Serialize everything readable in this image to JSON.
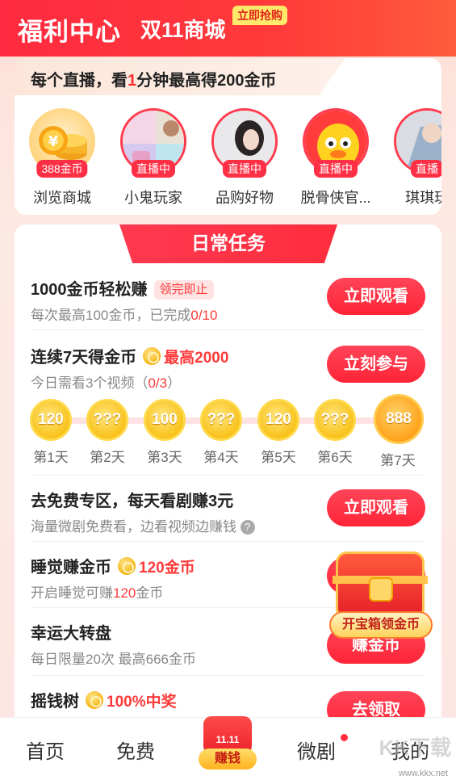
{
  "header": {
    "title": "福利中心",
    "subtitle": "双11商城",
    "badge": "立即抢购"
  },
  "live": {
    "banner_prefix": "每个直播，看",
    "banner_highlight": "1",
    "banner_suffix": "分钟最高得200金币",
    "items": [
      {
        "tag": "388金币",
        "name": "浏览商城"
      },
      {
        "tag": "直播中",
        "name": "小鬼玩家"
      },
      {
        "tag": "直播中",
        "name": "品购好物"
      },
      {
        "tag": "直播中",
        "name": "脱骨侠官..."
      },
      {
        "tag": "直播",
        "name": "琪琪玩"
      }
    ]
  },
  "tasks": {
    "tab_label": "日常任务",
    "task1": {
      "title": "1000金币轻松赚",
      "pill": "领完即止",
      "desc_prefix": "每次最高100金币，已完成",
      "desc_progress": "0/10",
      "button": "立即观看"
    },
    "task2": {
      "title": "连续7天得金币",
      "reward": "最高2000",
      "desc_prefix": "今日需看3个视频（",
      "desc_progress": "0/3",
      "desc_suffix": "）",
      "button": "立刻参与"
    },
    "days": [
      {
        "value": "120",
        "label": "第1天"
      },
      {
        "value": "???",
        "label": "第2天"
      },
      {
        "value": "100",
        "label": "第3天"
      },
      {
        "value": "???",
        "label": "第4天"
      },
      {
        "value": "120",
        "label": "第5天"
      },
      {
        "value": "???",
        "label": "第6天"
      },
      {
        "value": "888",
        "label": "第7天"
      }
    ],
    "task3": {
      "title": "去免费专区，每天看剧赚3元",
      "desc": "海量微剧免费看，边看视频边赚钱",
      "button": "立即观看"
    },
    "task4": {
      "title": "睡觉赚金币",
      "reward": "120金币",
      "desc_prefix": "开启睡觉可赚",
      "desc_highlight": "120",
      "desc_suffix": "金币"
    },
    "task5": {
      "title": "幸运大转盘",
      "desc": "每日限量20次 最高666金币",
      "button": "赚金币"
    },
    "task6": {
      "title": "摇钱树",
      "reward": "100%中奖",
      "button": "去领取"
    },
    "chest_label": "开宝箱领金币"
  },
  "nav": {
    "home": "首页",
    "free": "免费",
    "center_tag": "11.11",
    "center_label": "赚钱",
    "drama": "微剧",
    "mine": "我的"
  },
  "watermark": {
    "brand": "KK下载",
    "url": "www.kkx.net"
  },
  "colors": {
    "accent": "#ff2a3f",
    "gold": "#f8c21a",
    "highlight": "#ff3a3a"
  }
}
